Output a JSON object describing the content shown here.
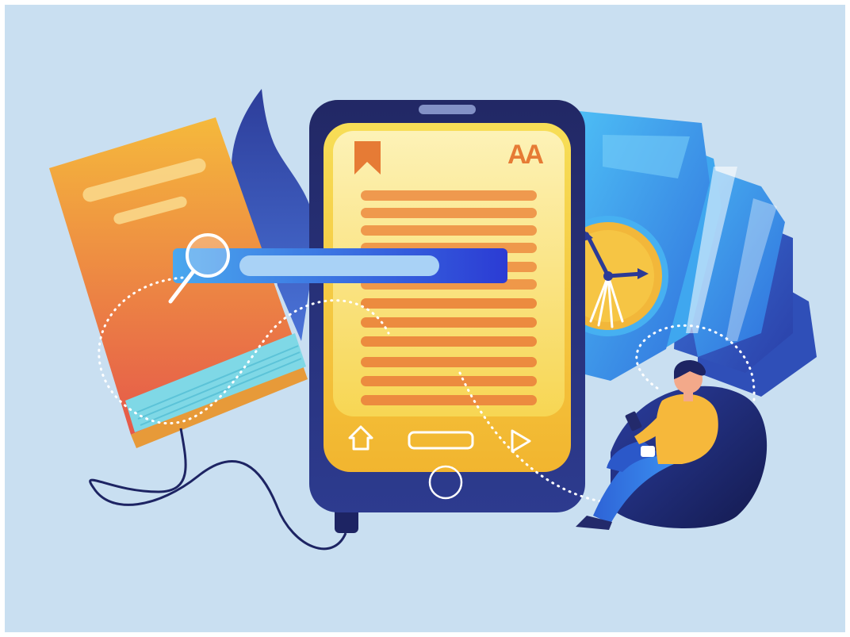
{
  "scene": {
    "background": "#c9dff1",
    "frame": "#ffffff"
  },
  "reader": {
    "font_size_glyph": "AA",
    "bookmark_icon": "bookmark-icon",
    "home_icon": "home-icon",
    "next_icon": "play-icon",
    "home_button_icon": "circle-button-icon"
  },
  "search": {
    "icon": "magnifier-icon"
  },
  "palette": {
    "device_body": "#232a6b",
    "screen_yellow": "#f7d443",
    "text_lines": "#ec8b3f",
    "book_orange": "#f0a93a",
    "search_bar_blue": "#2f49d8",
    "stack_cyan": "#3aa8f0",
    "clock_face": "#f2b73a",
    "cable": "#1d2463"
  }
}
